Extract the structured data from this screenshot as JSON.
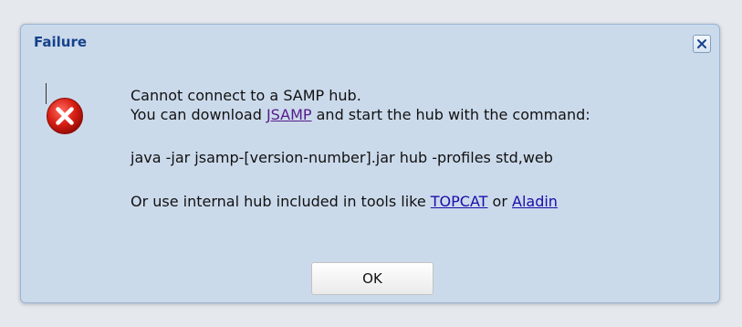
{
  "dialog": {
    "title": "Failure",
    "close_icon": "close-x-icon",
    "error_icon": "error-x-circle-icon",
    "line1": "Cannot connect to a SAMP hub.",
    "line2_before": "You can download ",
    "line2_link": "JSAMP",
    "line2_after": " and start the hub with the command:",
    "command": "java -jar jsamp-[version-number].jar hub -profiles std,web",
    "line4_before": "Or use internal hub included in tools like ",
    "link_topcat": "TOPCAT",
    "line4_or": " or ",
    "link_aladin": "Aladin",
    "ok_label": "OK"
  },
  "colors": {
    "title": "#15428b",
    "error_red": "#cc1111",
    "link": "#1a0dab",
    "visited_link": "#551a8b",
    "dialog_bg": "#cbdaeb"
  }
}
